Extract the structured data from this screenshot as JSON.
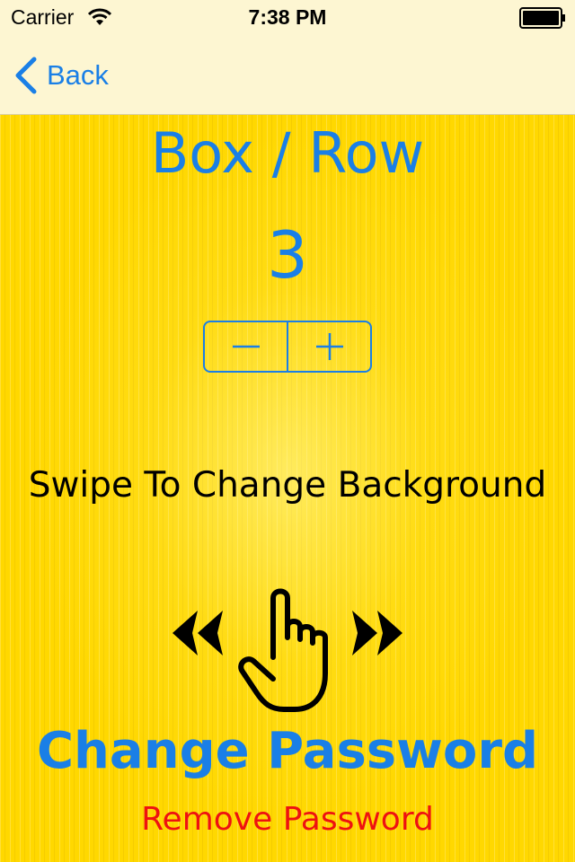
{
  "status_bar": {
    "carrier": "Carrier",
    "time": "7:38 PM",
    "icons": [
      "wifi-icon",
      "battery-icon"
    ]
  },
  "nav": {
    "back_label": "Back"
  },
  "settings": {
    "title": "Box / Row",
    "count": "3",
    "stepper": {
      "decrement_icon": "minus-icon",
      "increment_icon": "plus-icon"
    },
    "swipe_label": "Swipe To Change Background",
    "swipe_icons": [
      "chevrons-left-icon",
      "hand-pointer-icon",
      "chevrons-right-icon"
    ],
    "change_password_label": "Change Password",
    "remove_password_label": "Remove Password"
  },
  "colors": {
    "accent": "#1a7fe6",
    "destructive": "#ee1111",
    "background": "#ffd800",
    "bar_background": "#fdf6d2"
  }
}
